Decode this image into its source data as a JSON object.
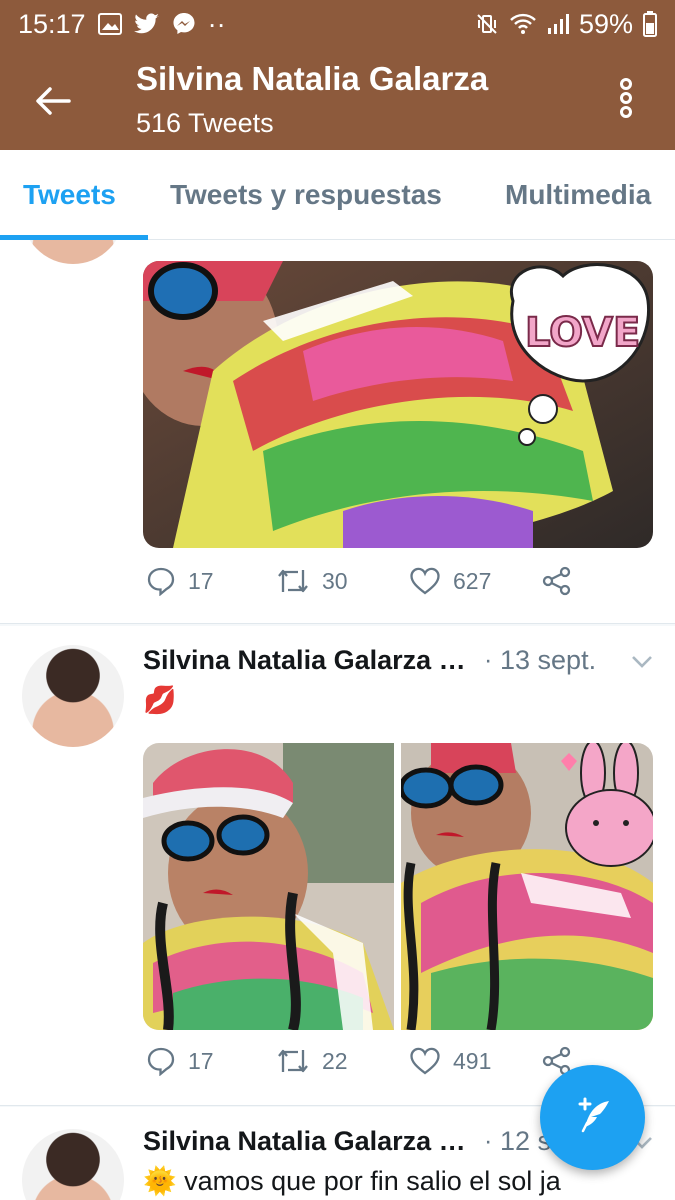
{
  "status_bar": {
    "time": "15:17",
    "dots": "··",
    "battery": "59%"
  },
  "header": {
    "title": "Silvina Natalia Galarza",
    "subtitle": "516 Tweets"
  },
  "tabs": [
    {
      "label": "Tweets",
      "active": true
    },
    {
      "label": "Tweets y respuestas",
      "active": false
    },
    {
      "label": "Multimedia",
      "active": false
    }
  ],
  "tweets": [
    {
      "actions": {
        "replies": "17",
        "retweets": "30",
        "likes": "627"
      }
    },
    {
      "author": "Silvina Natalia Galarza …",
      "date": "13 sept.",
      "text": "💋",
      "actions": {
        "replies": "17",
        "retweets": "22",
        "likes": "491"
      }
    },
    {
      "author": "Silvina Natalia Galarza …",
      "date": "12 s",
      "text": "🌞 vamos que por fin salio el sol ja"
    }
  ],
  "sticker": {
    "love_text": "LOVE"
  },
  "colors": {
    "brand_header": "#8d5a3c",
    "accent": "#1da1f2",
    "muted": "#657786"
  }
}
